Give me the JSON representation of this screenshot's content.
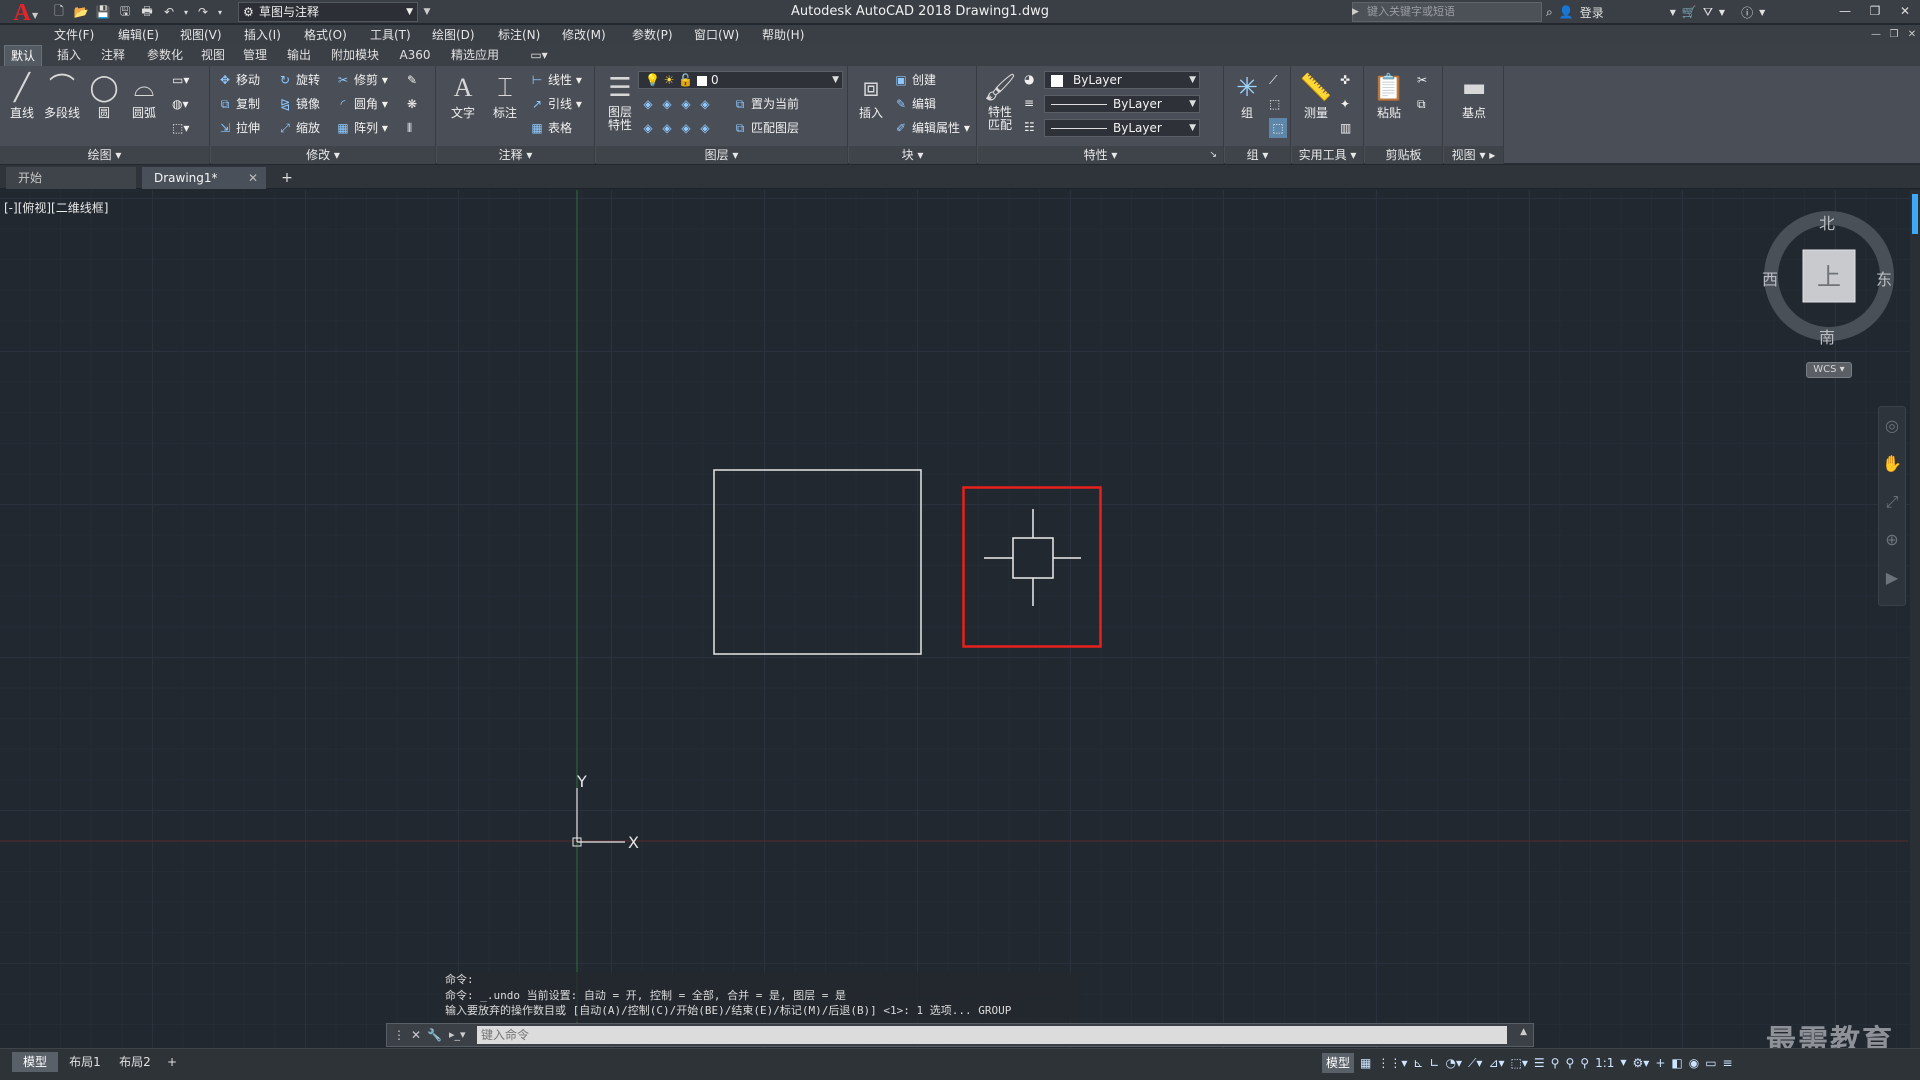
{
  "app": {
    "title": "Autodesk AutoCAD 2018    Drawing1.dwg",
    "logo_letter": "A",
    "workspace": "草图与注释",
    "search_placeholder": "键入关键字或短语",
    "login_label": "登录"
  },
  "menu": [
    "文件(F)",
    "编辑(E)",
    "视图(V)",
    "插入(I)",
    "格式(O)",
    "工具(T)",
    "绘图(D)",
    "标注(N)",
    "修改(M)",
    "参数(P)",
    "窗口(W)",
    "帮助(H)"
  ],
  "ribbon_tabs": [
    "默认",
    "插入",
    "注释",
    "参数化",
    "视图",
    "管理",
    "输出",
    "附加模块",
    "A360",
    "精选应用"
  ],
  "ribbon": {
    "draw": {
      "title": "绘图",
      "line": "直线",
      "polyline": "多段线",
      "circle": "圆",
      "arc": "圆弧"
    },
    "modify": {
      "title": "修改",
      "move": "移动",
      "rotate": "旋转",
      "trim": "修剪",
      "copy": "复制",
      "mirror": "镜像",
      "fillet": "圆角",
      "stretch": "拉伸",
      "scale": "缩放",
      "array": "阵列"
    },
    "annotation": {
      "title": "注释",
      "text": "文字",
      "dimension": "标注",
      "linear": "线性",
      "leader": "引线",
      "table": "表格"
    },
    "layers": {
      "title": "图层",
      "properties": "图层\n特性",
      "current_layer": "0",
      "set_current": "置为当前",
      "match_layer": "匹配图层"
    },
    "block": {
      "title": "块",
      "insert": "插入",
      "create": "创建",
      "edit": "编辑",
      "edit_attr": "编辑属性"
    },
    "properties": {
      "title": "特性",
      "match": "特性\n匹配",
      "color": "ByLayer",
      "linetype": "ByLayer",
      "lineweight": "ByLayer"
    },
    "groups": {
      "title": "组",
      "group": "组"
    },
    "utilities": {
      "title": "实用工具",
      "measure": "测量"
    },
    "clipboard": {
      "title": "剪贴板",
      "paste": "粘贴"
    },
    "view": {
      "title": "视图",
      "base": "基点"
    }
  },
  "doc_tabs": {
    "start": "开始",
    "drawing": "Drawing1*"
  },
  "viewport": {
    "label": "[-][俯视][二维线框]"
  },
  "viewcube": {
    "north": "北",
    "south": "南",
    "east": "东",
    "west": "西",
    "top": "上",
    "wcs": "WCS"
  },
  "ucs": {
    "x": "X",
    "y": "Y"
  },
  "command": {
    "history": [
      "命令:",
      "命令: _.undo 当前设置: 自动 = 开, 控制 = 全部, 合并 = 是, 图层 = 是",
      "输入要放弃的操作数目或 [自动(A)/控制(C)/开始(BE)/结束(E)/标记(M)/后退(B)] <1>: 1 选项... GROUP"
    ],
    "placeholder": "键入命令"
  },
  "layout_tabs": [
    "模型",
    "布局1",
    "布局2"
  ],
  "status": {
    "model": "模型",
    "scale": "1:1"
  },
  "watermark": "最需教育",
  "colors": {
    "highlight_box": "#e8201e",
    "canvas": "#212830",
    "y_axis": "#2e6e2e",
    "x_axis": "#5a2a2a"
  }
}
